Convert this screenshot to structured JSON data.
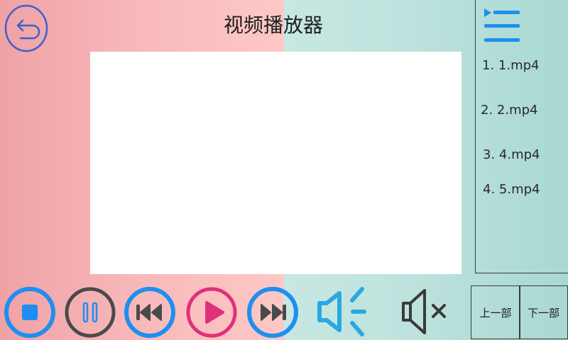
{
  "window": {
    "title": "视频播放器"
  },
  "colors": {
    "blue_accent": "#1e8ff0",
    "dark_gray": "#4a4a4a",
    "pink_accent": "#e0307a",
    "volume_blue": "#29a9e3"
  },
  "playlist": {
    "items": [
      {
        "index": "1.",
        "name": "1.mp4"
      },
      {
        "index": "2.",
        "name": "2.mp4"
      },
      {
        "index": "3.",
        "name": "4.mp4"
      },
      {
        "index": "4.",
        "name": "5.mp4"
      }
    ]
  },
  "controls": {
    "icons": [
      "back-icon",
      "playlist-menu-icon",
      "stop-icon",
      "pause-icon",
      "rewind-icon",
      "play-icon",
      "fast-forward-icon",
      "volume-on-icon",
      "mute-icon"
    ]
  },
  "nav": {
    "prev_label": "上一部",
    "next_label": "下一部"
  }
}
